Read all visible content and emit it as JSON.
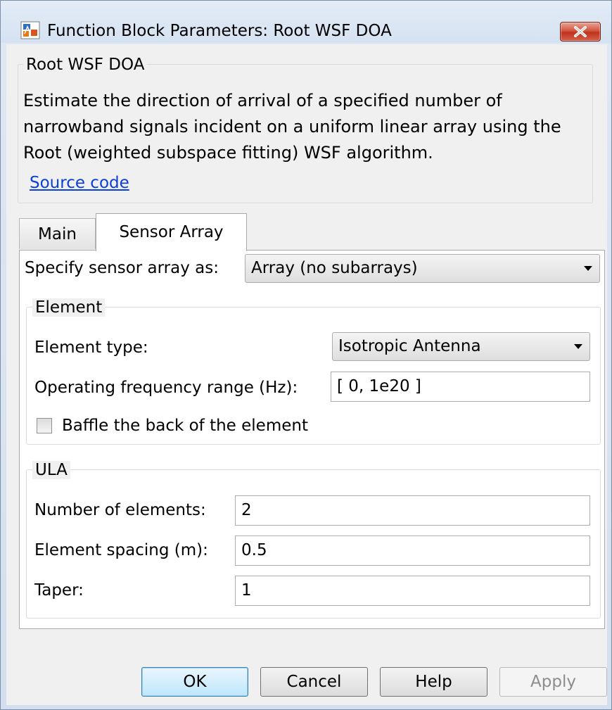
{
  "window": {
    "title": "Function Block Parameters: Root WSF DOA"
  },
  "description": {
    "group_title": "Root WSF DOA",
    "lines": [
      "Estimate the direction of arrival of a specified number of",
      "narrowband signals incident on a uniform linear array using the",
      "Root (weighted subspace fitting) WSF algorithm."
    ],
    "source_link": "Source code"
  },
  "tabs": [
    {
      "label": "Main",
      "active": false
    },
    {
      "label": "Sensor Array",
      "active": true
    }
  ],
  "sensor_array": {
    "specify_label": "Specify sensor array as:",
    "specify_value": "Array (no subarrays)",
    "element": {
      "group_title": "Element",
      "type_label": "Element type:",
      "type_value": "Isotropic Antenna",
      "freq_label": "Operating frequency range (Hz):",
      "freq_value": "[ 0, 1e20 ]",
      "baffle_label": "Baffle the back of the element",
      "baffle_checked": false
    },
    "ula": {
      "group_title": "ULA",
      "num_label": "Number of elements:",
      "num_value": "2",
      "spacing_label": "Element spacing (m):",
      "spacing_value": "0.5",
      "taper_label": "Taper:",
      "taper_value": "1"
    }
  },
  "buttons": {
    "ok": "OK",
    "cancel": "Cancel",
    "help": "Help",
    "apply": "Apply"
  },
  "colors": {
    "link": "#0b3fd6",
    "close_button": "#c0321d",
    "default_button": "#bee6fd"
  }
}
